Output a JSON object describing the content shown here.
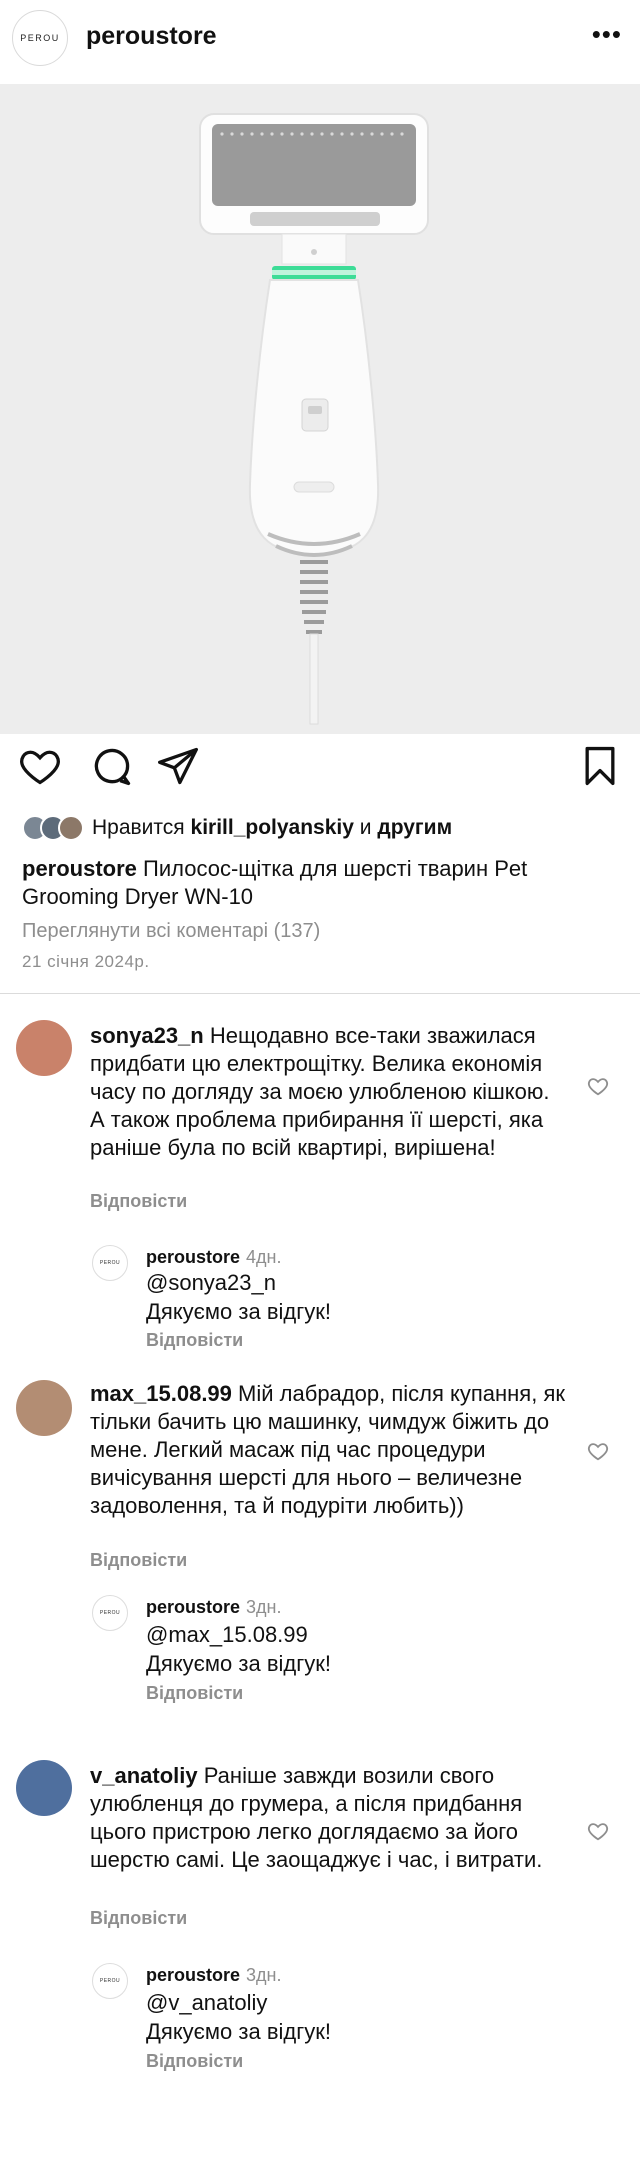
{
  "header": {
    "logo_text": "PEROU",
    "username": "peroustore",
    "more_icon": "more-horizontal-icon"
  },
  "post": {
    "image_alt": "white pet grooming dryer with slicker brush head",
    "likes": {
      "prefix": "Нравится",
      "user": "kirill_polyanskiy",
      "and": "и",
      "others": "другим"
    },
    "caption": {
      "user": "peroustore",
      "text": "Пилосос-щітка для шерсті тварин Pet Grooming Dryer WN-10"
    },
    "view_all": "Переглянути всі коментарі (137)",
    "date": "21 січня 2024р."
  },
  "comments": [
    {
      "user": "sonya23_n",
      "text": "Нещодавно все-таки зважилася придбати цю електрощітку. Велика економія часу по догляду за моєю улюбленою кішкою. А також проблема прибирання її шерсті, яка раніше була по всій квартирі, вирішена!",
      "reply_label": "Відповісти",
      "reply": {
        "user": "peroustore",
        "ago": "4дн.",
        "mention": "@sonya23_n",
        "text": "Дякуємо за відгук!",
        "reply_label": "Відповісти"
      }
    },
    {
      "user": "max_15.08.99",
      "text": "Мій лабрадор, після купання, як тільки бачить цю машинку, чимдуж біжить до мене. Легкий масаж під час процедури вичісування шерсті для нього – величезне задоволення, та й подуріти любить))",
      "reply_label": "Відповісти",
      "reply": {
        "user": "peroustore",
        "ago": "3дн.",
        "mention": "@max_15.08.99",
        "text": "Дякуємо за відгук!",
        "reply_label": "Відповісти"
      }
    },
    {
      "user": "v_anatoliy",
      "text": "Раніше завжди возили свого улюбленця до грумера, а після придбання цього пристрою легко доглядаємо за його шерстю самі. Це заощаджує і час, і витрати.",
      "reply_label": "Відповісти",
      "reply": {
        "user": "peroustore",
        "ago": "3дн.",
        "mention": "@v_anatoliy",
        "text": "Дякуємо за відгук!",
        "reply_label": "Відповісти"
      }
    }
  ],
  "colors": {
    "secondary_text": "#8e8e8e",
    "accent_ring": "#3ddc97",
    "divider": "#dbdbdb"
  }
}
